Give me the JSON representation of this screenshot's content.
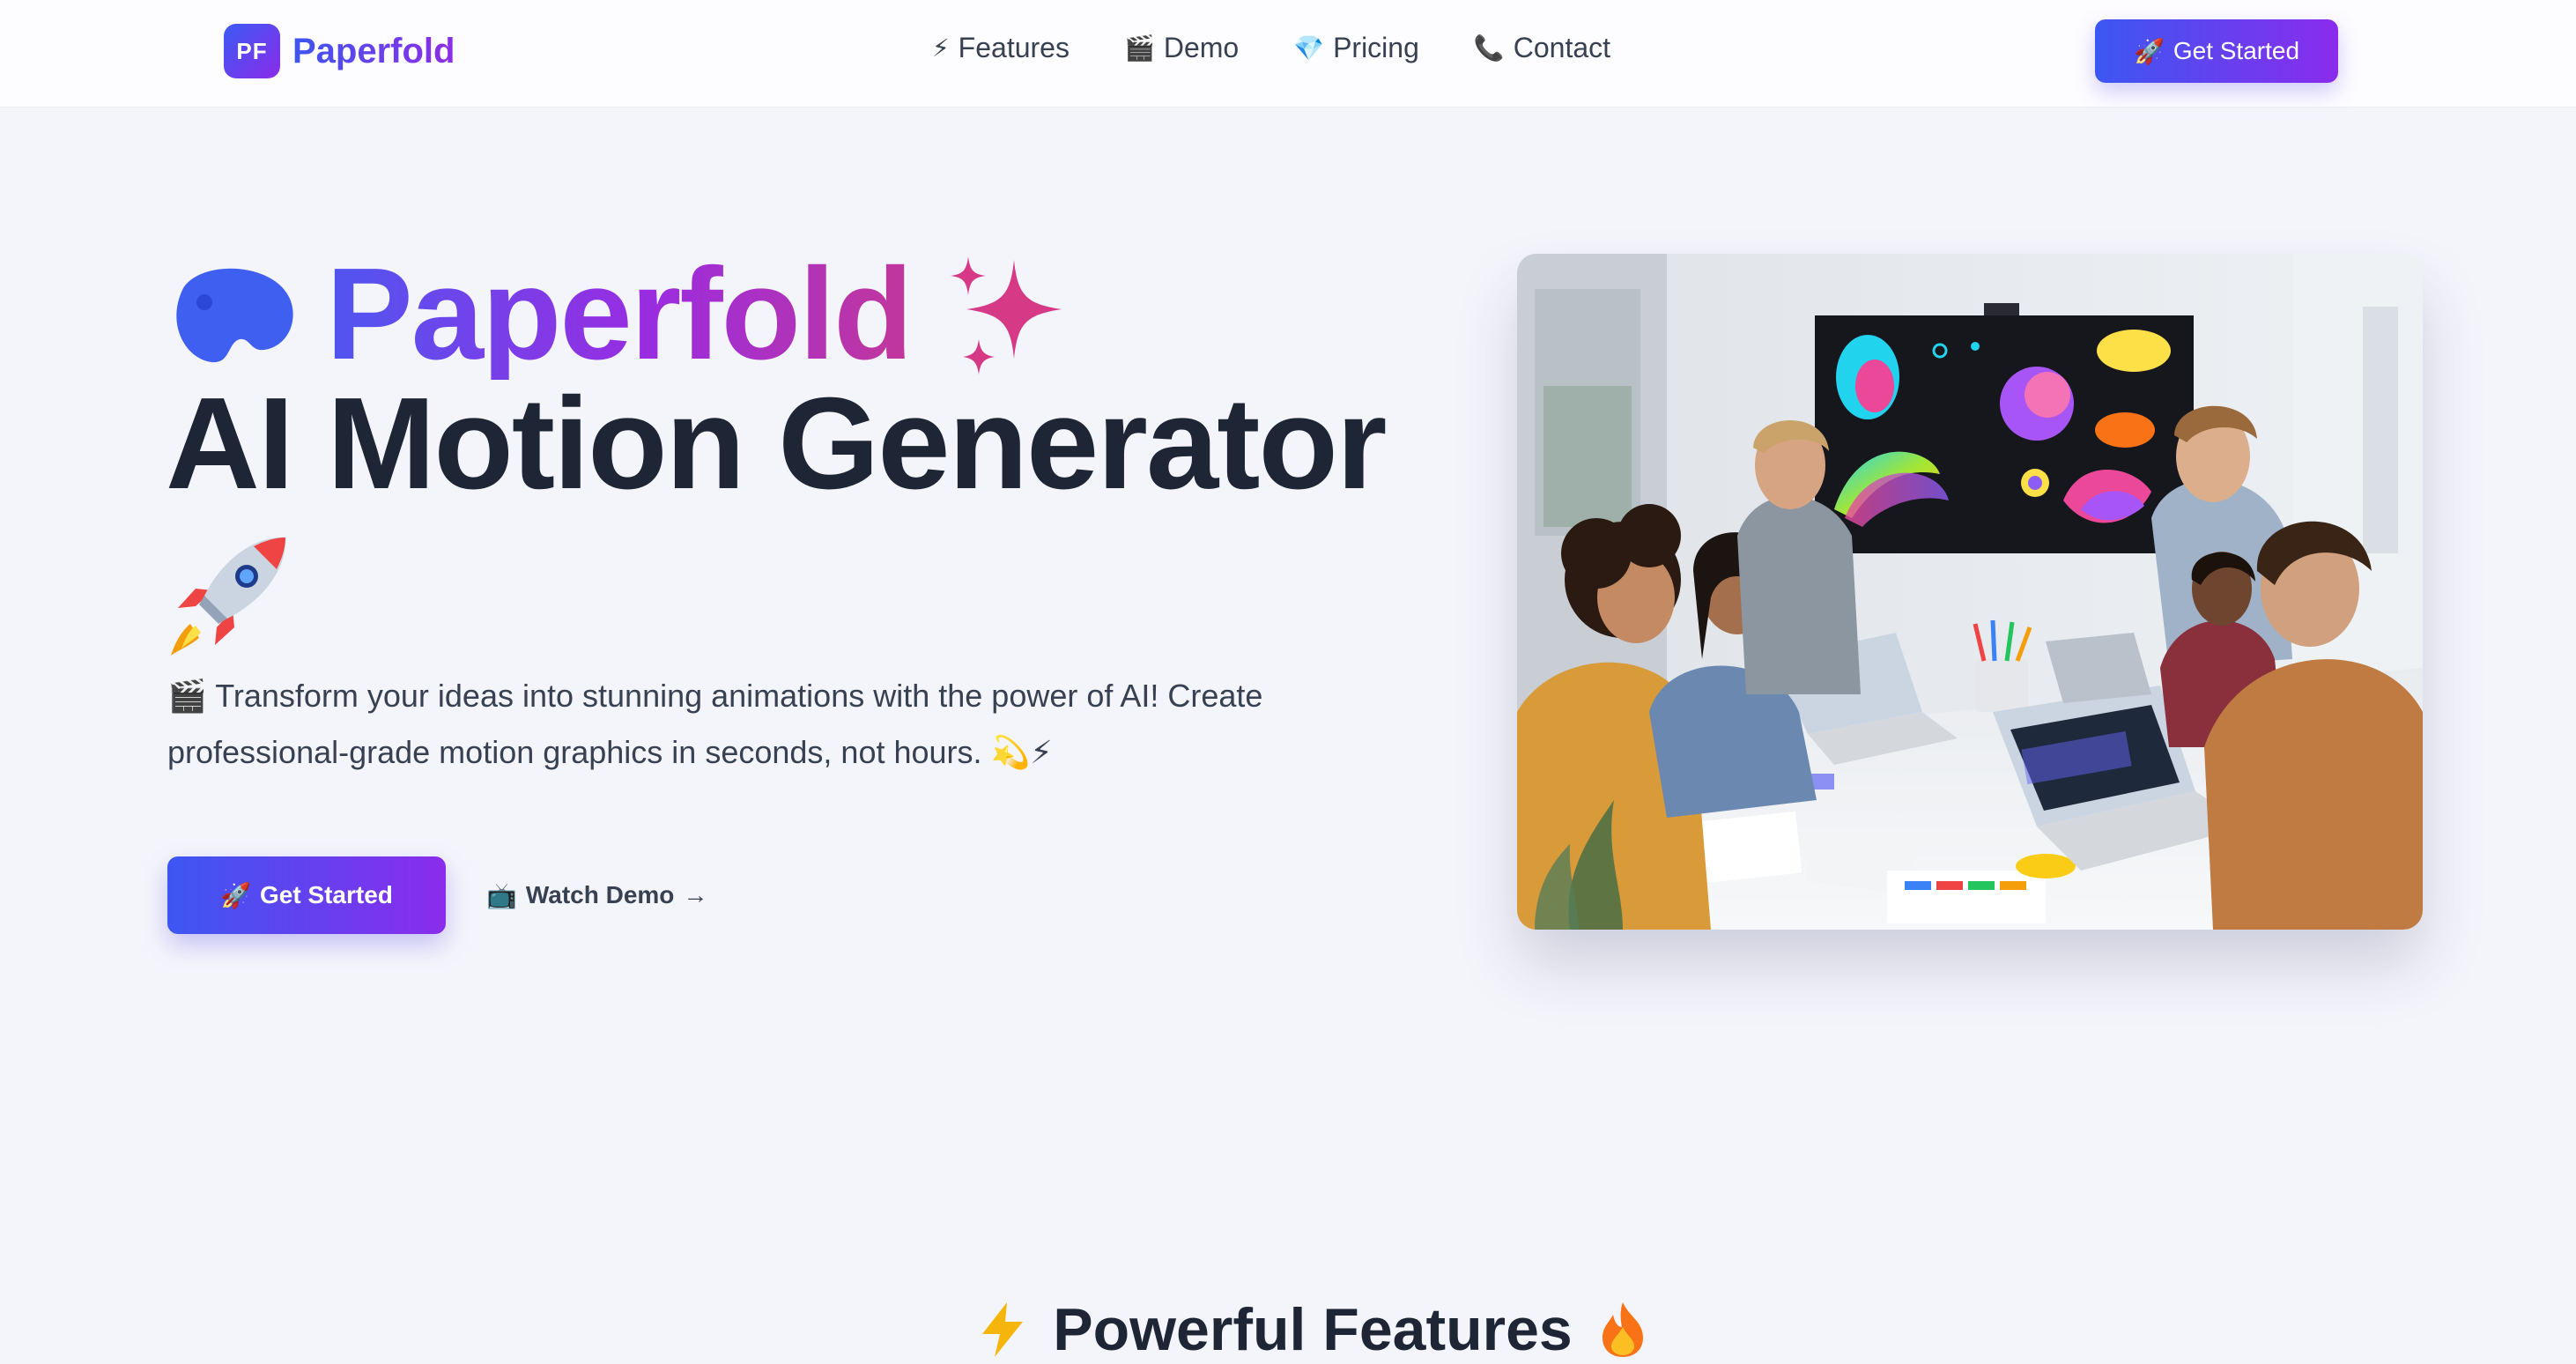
{
  "nav": {
    "logo_badge": "PF",
    "brand": "Paperfold",
    "links": [
      {
        "icon": "⚡",
        "label": "Features"
      },
      {
        "icon": "🎬",
        "label": "Demo"
      },
      {
        "icon": "💎",
        "label": "Pricing"
      },
      {
        "icon": "📞",
        "label": "Contact"
      }
    ],
    "cta": {
      "icon": "🚀",
      "label": "Get Started"
    }
  },
  "hero": {
    "title_brand": "Paperfold",
    "title_main": "AI Motion Generator",
    "subtitle_icon": "🎬",
    "subtitle_line1": "Transform your ideas into stunning animations with the power of AI! Create",
    "subtitle_line2": "professional-grade motion graphics in seconds, not hours.",
    "subtitle_emoji": "💫⚡",
    "cta": {
      "icon": "🚀",
      "label": "Get Started"
    },
    "secondary": {
      "icon": "📺",
      "label": "Watch Demo",
      "arrow": "→"
    }
  },
  "features": {
    "heading": "Powerful Features"
  },
  "colors": {
    "accent_start": "#3c57f3",
    "accent_end": "#8a2cec",
    "text_dark": "#1e2636",
    "page_bg": "#f4f5fb"
  },
  "icons": [
    "palette-icon",
    "sparkles-icon",
    "rocket-icon",
    "lightning-icon",
    "fire-icon"
  ]
}
